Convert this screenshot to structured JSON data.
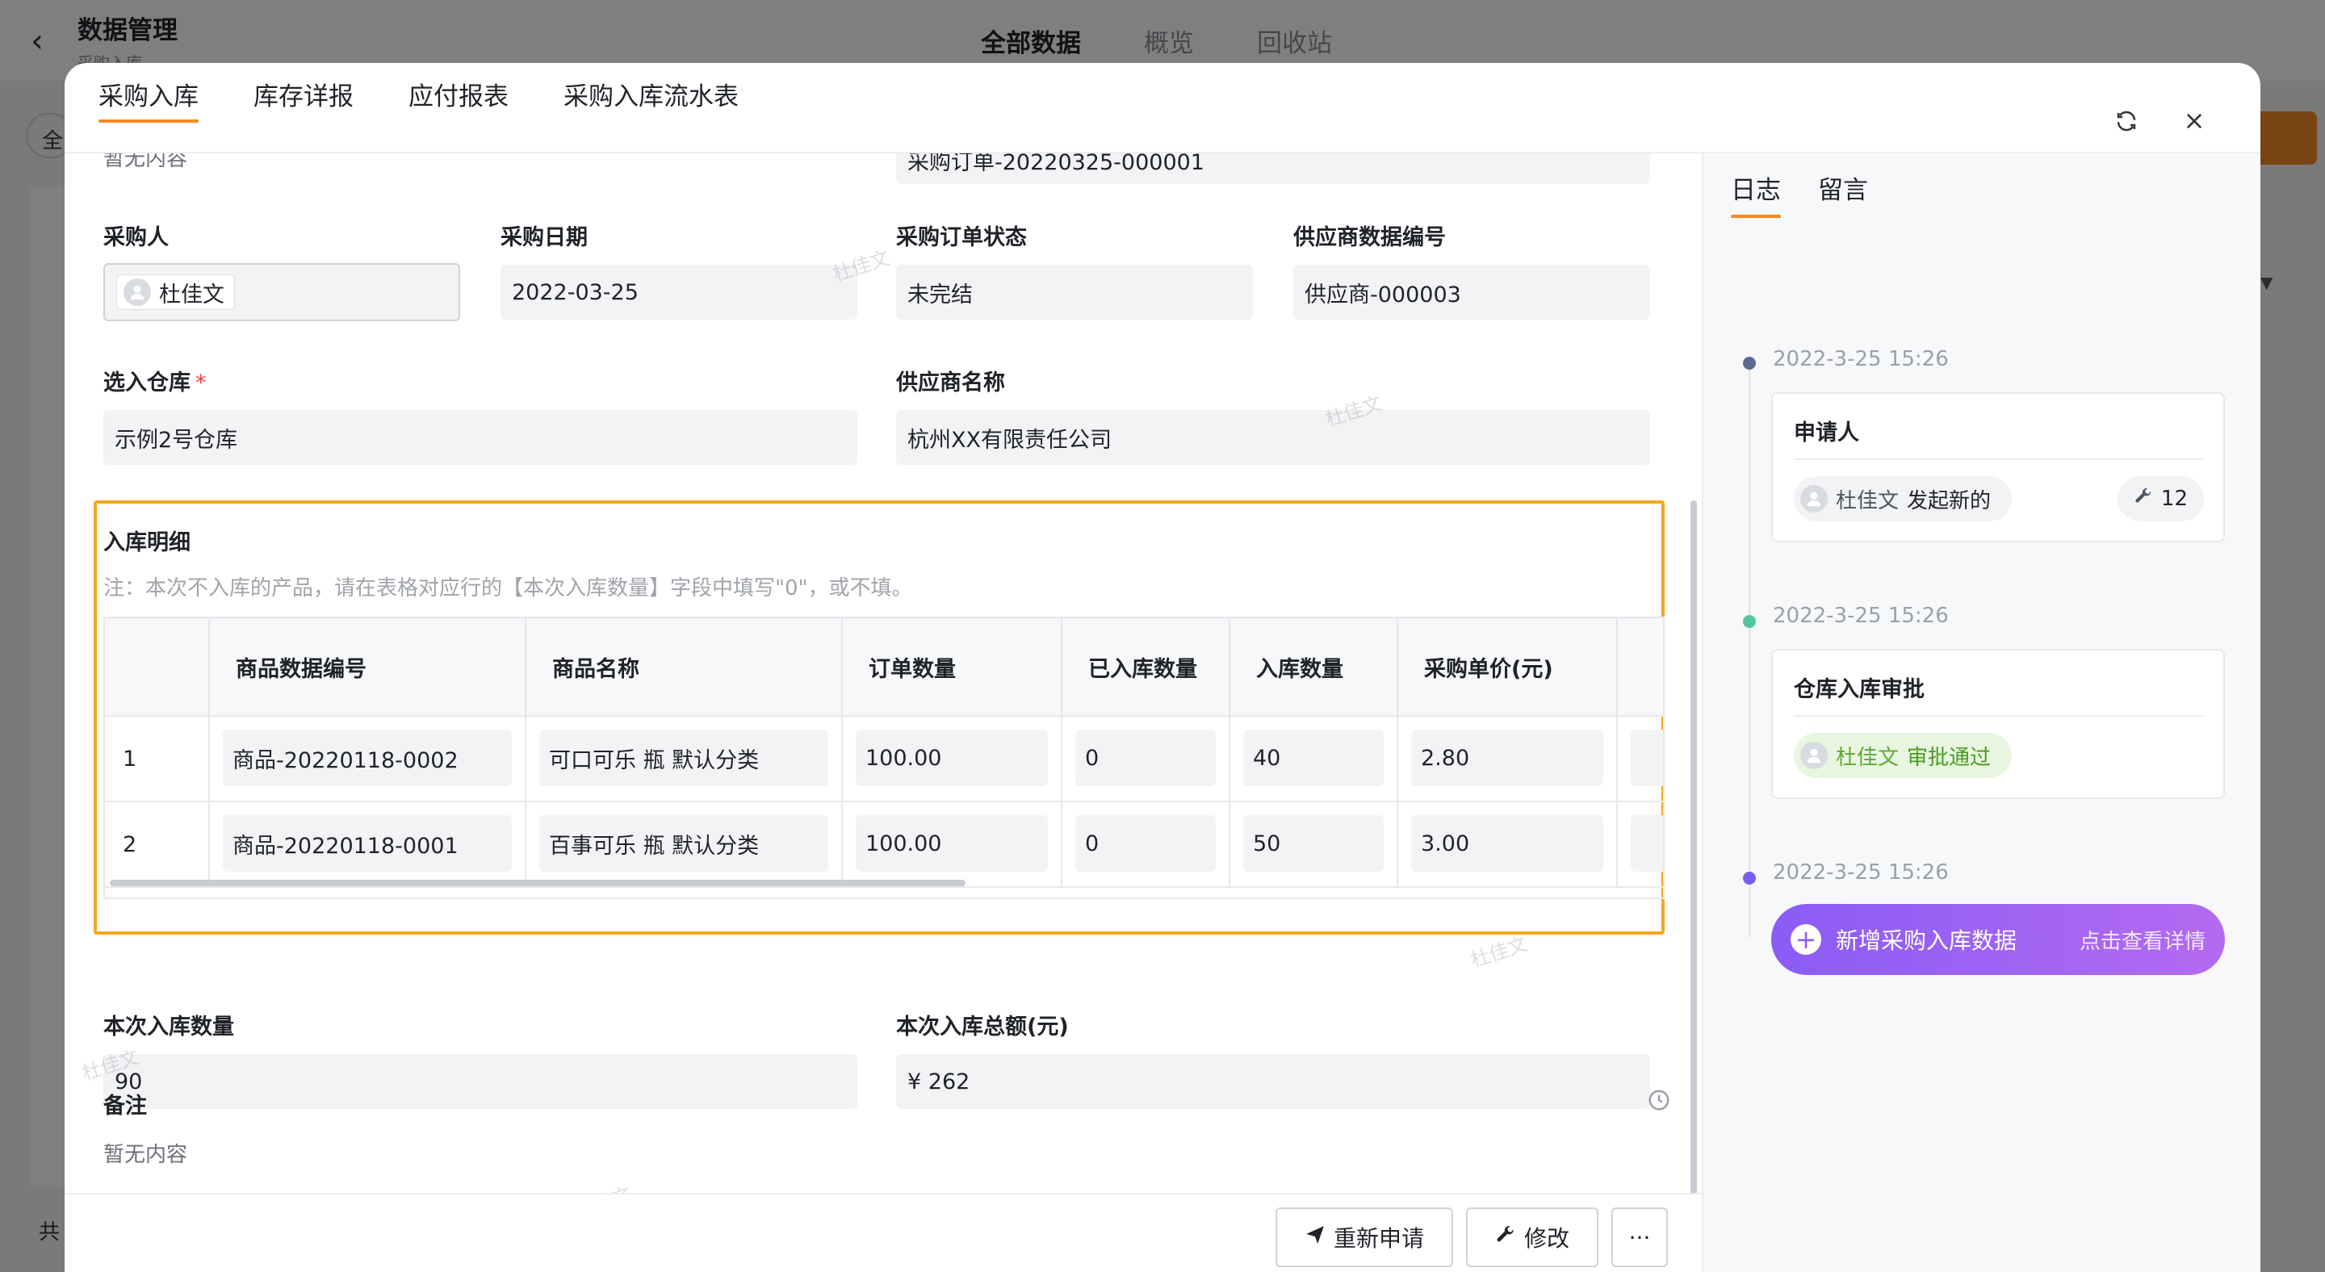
{
  "background": {
    "title": "数据管理",
    "subtitle": "采购入库",
    "tabs": [
      "全部数据",
      "概览",
      "回收站"
    ],
    "filter_label": "全",
    "footer_label": "共"
  },
  "modal": {
    "tabs": [
      "采购入库",
      "库存详报",
      "应付报表",
      "采购入库流水表"
    ],
    "top_left_value": "暂无内容",
    "order_number": "采购订单-20220325-000001",
    "fields": {
      "purchaser": {
        "label": "采购人",
        "value": "杜佳文"
      },
      "purchase_date": {
        "label": "采购日期",
        "value": "2022-03-25"
      },
      "order_status": {
        "label": "采购订单状态",
        "value": "未完结"
      },
      "supplier_code": {
        "label": "供应商数据编号",
        "value": "供应商-000003"
      },
      "warehouse": {
        "label": "选入仓库",
        "required_mark": "*",
        "value": "示例2号仓库"
      },
      "supplier_name": {
        "label": "供应商名称",
        "value": "杭州XX有限责任公司"
      }
    },
    "detail": {
      "title": "入库明细",
      "note": "注：本次不入库的产品，请在表格对应行的【本次入库数量】字段中填写\"0\"，或不填。",
      "columns": [
        "",
        "商品数据编号",
        "商品名称",
        "订单数量",
        "已入库数量",
        "入库数量",
        "采购单价(元)"
      ],
      "rows": [
        {
          "index": "1",
          "code": "商品-20220118-0002",
          "name": "可口可乐 瓶 默认分类",
          "order_qty": "100.00",
          "received_qty": "0",
          "in_qty": "40",
          "unit_price": "2.80"
        },
        {
          "index": "2",
          "code": "商品-20220118-0001",
          "name": "百事可乐 瓶 默认分类",
          "order_qty": "100.00",
          "received_qty": "0",
          "in_qty": "50",
          "unit_price": "3.00"
        }
      ]
    },
    "this_qty": {
      "label": "本次入库数量",
      "value": "90"
    },
    "this_amount": {
      "label": "本次入库总额(元)",
      "value": "¥ 262"
    },
    "remark": {
      "label": "备注",
      "value": "暂无内容"
    },
    "watermark": "杜佳文",
    "footer": {
      "reapply": "重新申请",
      "modify": "修改",
      "more": "···"
    }
  },
  "log_panel": {
    "tabs": [
      "日志",
      "留言"
    ],
    "entries": [
      {
        "time": "2022-3-25 15:26",
        "title": "申请人",
        "user": "杜佳文",
        "action": "发起新的",
        "count": "12",
        "dot_color": "#5b6b8f"
      },
      {
        "time": "2022-3-25 15:26",
        "title": "仓库入库审批",
        "user": "杜佳文",
        "action": "审批通过",
        "dot_color": "#52c59a"
      },
      {
        "time": "2022-3-25 15:26",
        "dot_color": "#7b5cf0"
      }
    ],
    "create_card": {
      "label": "新增采购入库数据",
      "link": "点击查看详情"
    }
  }
}
